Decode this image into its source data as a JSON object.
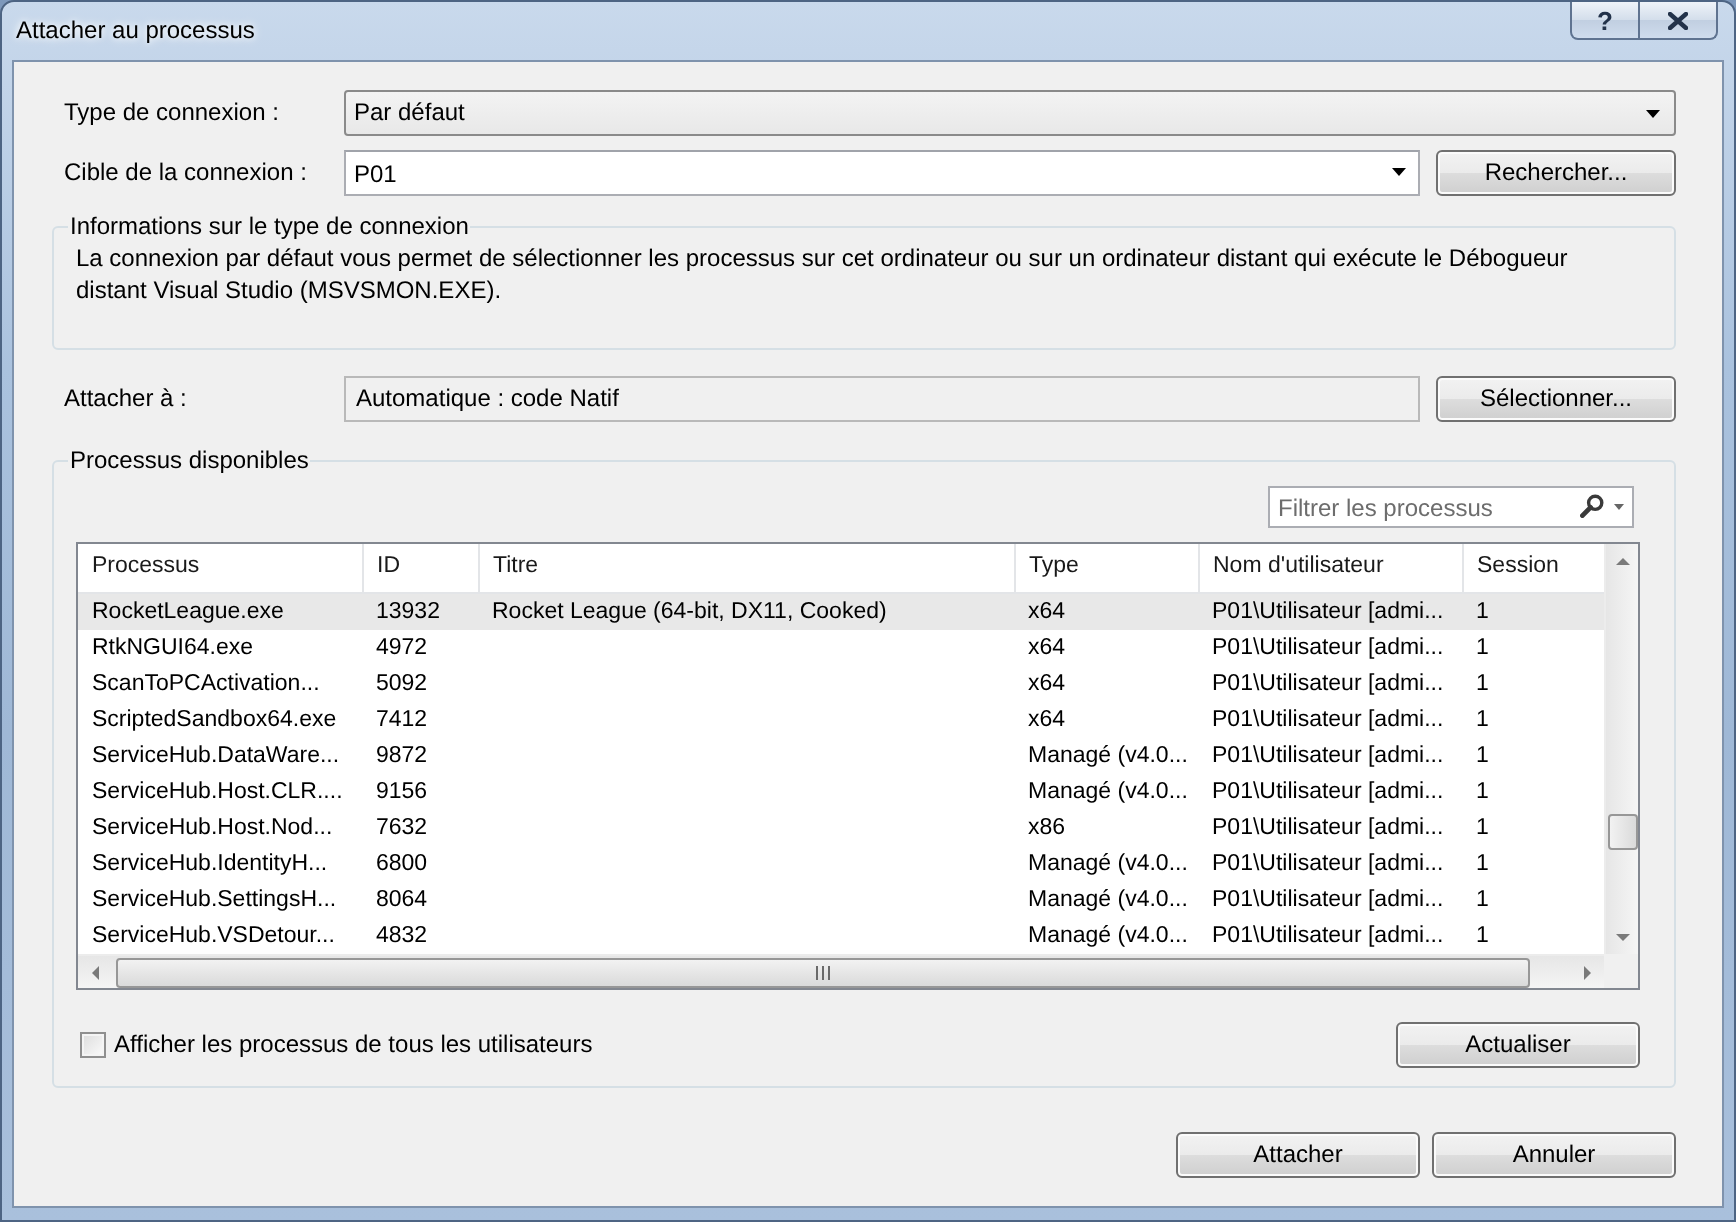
{
  "window": {
    "title": "Attacher au processus",
    "help_button": "?"
  },
  "connection_type": {
    "label": "Type de connexion :",
    "value": "Par défaut"
  },
  "connection_target": {
    "label": "Cible de la connexion :",
    "value": "P01",
    "button": "Rechercher..."
  },
  "connection_info": {
    "title": "Informations sur le type de connexion",
    "text": "La connexion par défaut vous permet de sélectionner les processus sur cet ordinateur ou sur un ordinateur distant qui exécute le Débogueur distant Visual Studio (MSVSMON.EXE)."
  },
  "attach_to": {
    "label": "Attacher à :",
    "value": "Automatique : code Natif",
    "button": "Sélectionner..."
  },
  "available_processes": {
    "title": "Processus disponibles",
    "filter": {
      "placeholder": "Filtrer les processus"
    },
    "table": {
      "columns": [
        "Processus",
        "ID",
        "Titre",
        "Type",
        "Nom d'utilisateur",
        "Session"
      ],
      "rows": [
        {
          "process": "RocketLeague.exe",
          "id": "13932",
          "title": "Rocket League (64-bit, DX11, Cooked)",
          "type": "x64",
          "user": "P01\\Utilisateur [admi...",
          "session": "1",
          "selected": true
        },
        {
          "process": "RtkNGUI64.exe",
          "id": "4972",
          "type": "x64",
          "user": "P01\\Utilisateur [admi...",
          "session": "1",
          "selected": false
        },
        {
          "process": "ScanToPCActivation...",
          "id": "5092",
          "type": "x64",
          "user": "P01\\Utilisateur [admi...",
          "session": "1",
          "selected": false
        },
        {
          "process": "ScriptedSandbox64.exe",
          "id": "7412",
          "type": "x64",
          "user": "P01\\Utilisateur [admi...",
          "session": "1",
          "selected": false
        },
        {
          "process": "ServiceHub.DataWare...",
          "id": "9872",
          "type": "Managé (v4.0...",
          "user": "P01\\Utilisateur [admi...",
          "session": "1",
          "selected": false
        },
        {
          "process": "ServiceHub.Host.CLR....",
          "id": "9156",
          "type": "Managé (v4.0...",
          "user": "P01\\Utilisateur [admi...",
          "session": "1",
          "selected": false
        },
        {
          "process": "ServiceHub.Host.Nod...",
          "id": "7632",
          "type": "x86",
          "user": "P01\\Utilisateur [admi...",
          "session": "1",
          "selected": false
        },
        {
          "process": "ServiceHub.IdentityH...",
          "id": "6800",
          "type": "Managé (v4.0...",
          "user": "P01\\Utilisateur [admi...",
          "session": "1",
          "selected": false
        },
        {
          "process": "ServiceHub.SettingsH...",
          "id": "8064",
          "type": "Managé (v4.0...",
          "user": "P01\\Utilisateur [admi...",
          "session": "1",
          "selected": false
        },
        {
          "process": "ServiceHub.VSDetour...",
          "id": "4832",
          "type": "Managé (v4.0...",
          "user": "P01\\Utilisateur [admi...",
          "session": "1",
          "selected": false
        }
      ]
    },
    "show_all_users": {
      "label": "Afficher les processus de tous les utilisateurs",
      "checked": false
    },
    "refresh_button": "Actualiser"
  },
  "buttons": [
    "Attacher",
    "Annuler"
  ]
}
